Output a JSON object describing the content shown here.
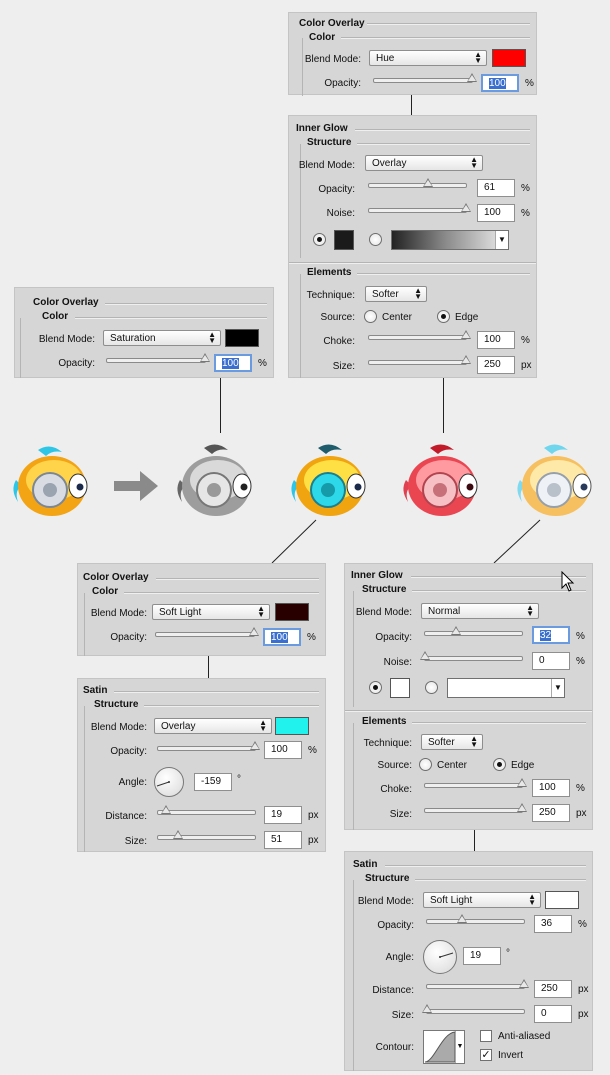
{
  "colors": {
    "panel": "#d6d6d6",
    "red": "#ff0000",
    "black": "#000000",
    "dark_red": "#280000",
    "cyan": "#22f2ee",
    "white": "#ffffff",
    "inner_glow_black": "#1a1a1a"
  },
  "panel_top_color_overlay": {
    "title": "Color Overlay",
    "section": "Color",
    "blend_label": "Blend Mode:",
    "blend_value": "Hue",
    "opacity_label": "Opacity:",
    "opacity_value": "100",
    "opacity_unit": "%",
    "opacity_level": 100
  },
  "panel_top_inner_glow": {
    "title": "Inner Glow",
    "section": "Structure",
    "blend_label": "Blend Mode:",
    "blend_value": "Overlay",
    "opacity_label": "Opacity:",
    "opacity_value": "61",
    "opacity_unit": "%",
    "opacity_level": 61,
    "noise_label": "Noise:",
    "noise_value": "100",
    "noise_unit": "%",
    "noise_level": 100,
    "elements_title": "Elements",
    "technique_label": "Technique:",
    "technique_value": "Softer",
    "source_label": "Source:",
    "source_center": "Center",
    "source_edge": "Edge",
    "choke_label": "Choke:",
    "choke_value": "100",
    "choke_unit": "%",
    "choke_level": 100,
    "size_label": "Size:",
    "size_value": "250",
    "size_unit": "px",
    "size_level": 100
  },
  "panel_left_color_overlay": {
    "title": "Color Overlay",
    "section": "Color",
    "blend_label": "Blend Mode:",
    "blend_value": "Saturation",
    "opacity_label": "Opacity:",
    "opacity_value": "100",
    "opacity_unit": "%",
    "opacity_level": 100
  },
  "panel_bottom_color_overlay": {
    "title": "Color Overlay",
    "section": "Color",
    "blend_label": "Blend Mode:",
    "blend_value": "Soft Light",
    "opacity_label": "Opacity:",
    "opacity_value": "100",
    "opacity_unit": "%",
    "opacity_level": 100
  },
  "panel_bottom_satin": {
    "title": "Satin",
    "section": "Structure",
    "blend_label": "Blend Mode:",
    "blend_value": "Overlay",
    "opacity_label": "Opacity:",
    "opacity_value": "100",
    "opacity_unit": "%",
    "opacity_level": 100,
    "angle_label": "Angle:",
    "angle_value": "-159",
    "angle_unit": "°",
    "distance_label": "Distance:",
    "distance_value": "19",
    "distance_unit": "px",
    "distance_level": 8,
    "size_label": "Size:",
    "size_value": "51",
    "size_unit": "px",
    "size_level": 21
  },
  "panel_right_inner_glow": {
    "title": "Inner Glow",
    "section": "Structure",
    "blend_label": "Blend Mode:",
    "blend_value": "Normal",
    "opacity_label": "Opacity:",
    "opacity_value": "32",
    "opacity_unit": "%",
    "opacity_level": 32,
    "noise_label": "Noise:",
    "noise_value": "0",
    "noise_unit": "%",
    "noise_level": 0,
    "elements_title": "Elements",
    "technique_label": "Technique:",
    "technique_value": "Softer",
    "source_label": "Source:",
    "source_center": "Center",
    "source_edge": "Edge",
    "choke_label": "Choke:",
    "choke_value": "100",
    "choke_unit": "%",
    "choke_level": 100,
    "size_label": "Size:",
    "size_value": "250",
    "size_unit": "px",
    "size_level": 100
  },
  "panel_right_satin": {
    "title": "Satin",
    "section": "Structure",
    "blend_label": "Blend Mode:",
    "blend_value": "Soft Light",
    "opacity_label": "Opacity:",
    "opacity_value": "36",
    "opacity_unit": "%",
    "opacity_level": 36,
    "angle_label": "Angle:",
    "angle_value": "19",
    "angle_unit": "°",
    "distance_label": "Distance:",
    "distance_value": "250",
    "distance_unit": "px",
    "distance_level": 100,
    "size_label": "Size:",
    "size_value": "0",
    "size_unit": "px",
    "size_level": 0,
    "contour_label": "Contour:",
    "anti_aliased_label": "Anti-aliased",
    "anti_aliased_checked": false,
    "invert_label": "Invert",
    "invert_checked": true
  },
  "icons": [
    "arrow-right-icon",
    "mouse-cursor-icon",
    "fish-original-icon",
    "fish-grayscale-icon",
    "fish-cyan-icon",
    "fish-red-icon",
    "fish-final-icon"
  ]
}
